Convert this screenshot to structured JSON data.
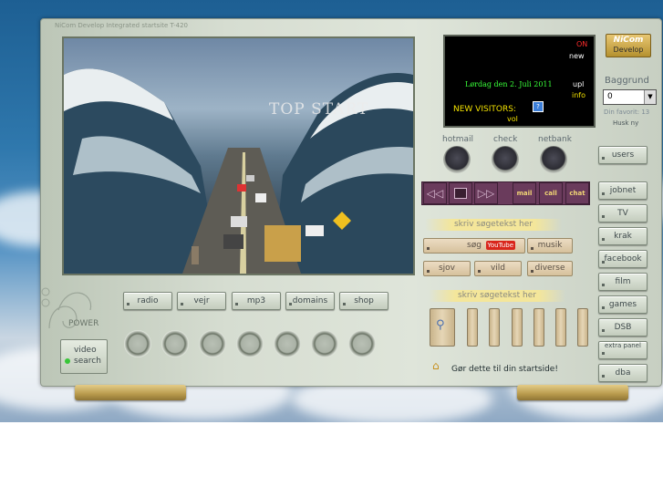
{
  "panel": {
    "title": "NiCom Develop Integrated startsite T-420"
  },
  "screen": {
    "overlay_text": "TOP START"
  },
  "info_display": {
    "date": "Lørdag den 2. Juli 2011",
    "visitors_label": "NEW VISITORS:",
    "links": [
      "ON",
      "new",
      "upl",
      "info",
      "vol"
    ]
  },
  "logo": {
    "line1": "NiCom",
    "line2": "Develop"
  },
  "baggrund": {
    "label": "Baggrund",
    "selected": "0",
    "favorit": "Din favorit: 13",
    "husk": "Husk ny"
  },
  "knobs": {
    "labels": [
      "hotmail",
      "check",
      "netbank"
    ]
  },
  "transport": {
    "labels": [
      "mail",
      "call",
      "chat"
    ]
  },
  "search_top": {
    "header": "skriv søgetekst her",
    "row1": [
      "søg",
      "musik"
    ],
    "row2": [
      "sjov",
      "vild",
      "diverse"
    ],
    "youtube": "YouTube"
  },
  "search_bottom": {
    "header": "skriv søgetekst her",
    "slot_labels": [
      "",
      "",
      "",
      "",
      "",
      "",
      ""
    ]
  },
  "bottom_bar": {
    "items": [
      "radio",
      "vejr",
      "mp3",
      "domains",
      "shop"
    ]
  },
  "power": {
    "label": "POWER",
    "video": "video",
    "search": "search"
  },
  "sidebar": {
    "items": [
      "users",
      "jobnet",
      "TV",
      "krak",
      "facebook",
      "film",
      "games",
      "DSB",
      "extra panel",
      "dba"
    ]
  },
  "startpage": {
    "text": "Gør dette til din startside!"
  },
  "colors": {
    "green_text": "#39ff39",
    "yellow_text": "#f2e100",
    "red_on": "#ff2b2b",
    "tan": "#d6c19c",
    "purple": "#6a3b5c"
  }
}
